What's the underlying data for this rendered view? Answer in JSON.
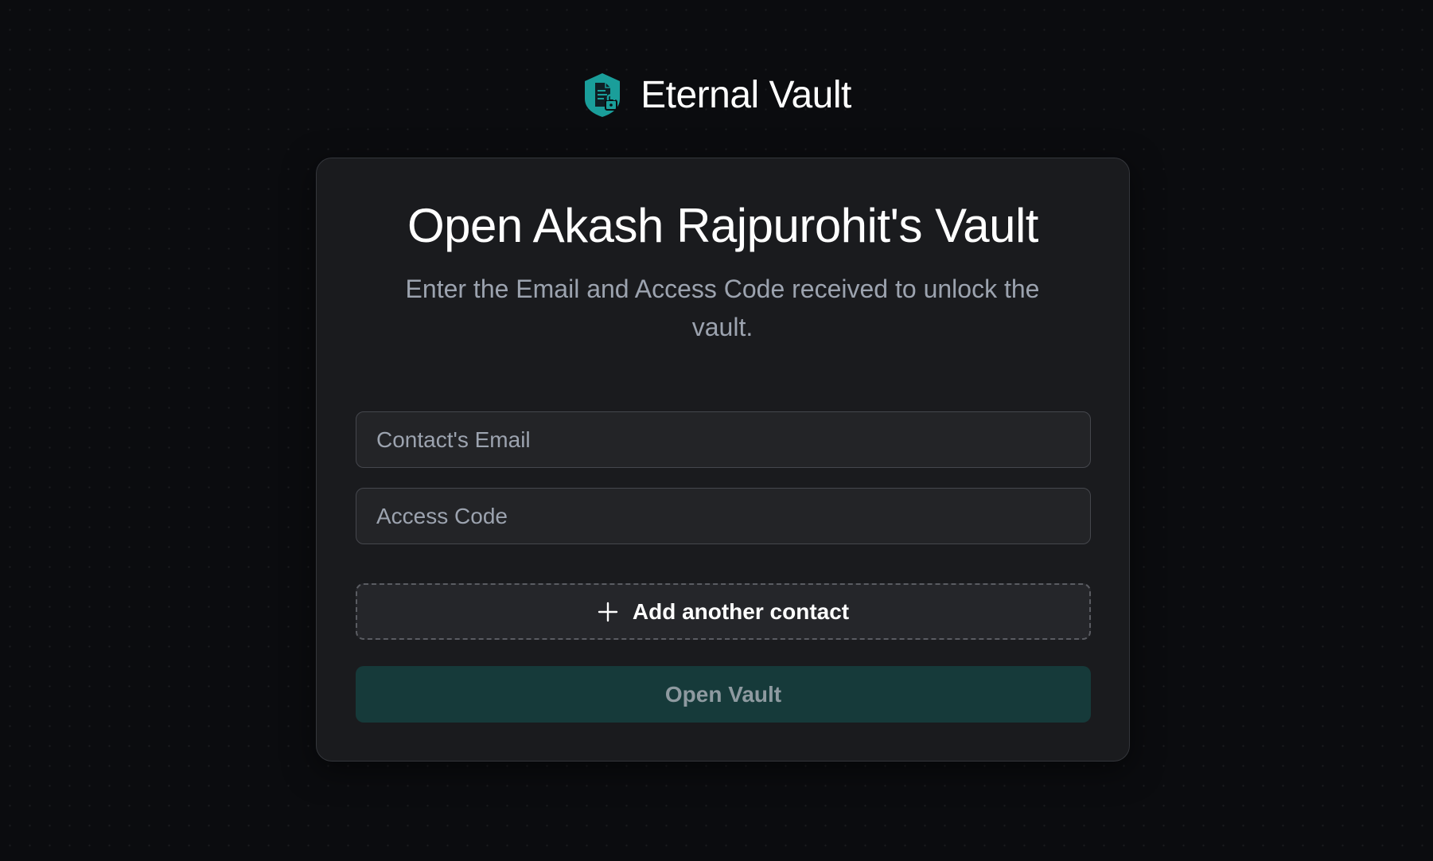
{
  "brand": {
    "name": "Eternal Vault",
    "logo_icon": "shield-document-lock-icon",
    "accent_color": "#1a9e9a"
  },
  "card": {
    "title": "Open Akash Rajpurohit's Vault",
    "subtitle": "Enter the Email and Access Code received to unlock the vault."
  },
  "form": {
    "email": {
      "placeholder": "Contact's Email",
      "value": ""
    },
    "access_code": {
      "placeholder": "Access Code",
      "value": ""
    },
    "add_contact": {
      "label": "Add another contact",
      "icon": "plus-icon"
    },
    "submit": {
      "label": "Open Vault",
      "disabled": true,
      "color": "#163a3a"
    }
  }
}
